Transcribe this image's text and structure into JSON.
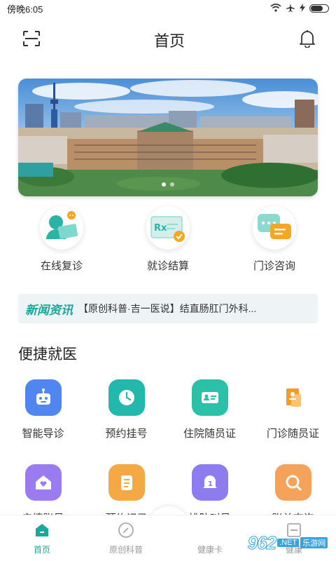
{
  "status_bar": {
    "time": "傍晚6:05",
    "battery_level": 0.7
  },
  "header": {
    "title": "首页",
    "scan_icon": "scan-icon",
    "bell_icon": "bell-icon"
  },
  "banner": {
    "slide_count": 2,
    "active_slide": 1
  },
  "quick_actions": [
    {
      "label": "在线复诊",
      "icon": "online-consult-icon"
    },
    {
      "label": "就诊结算",
      "icon": "prescription-icon"
    },
    {
      "label": "门诊咨询",
      "icon": "chat-icon"
    }
  ],
  "news": {
    "tag": "新闻资讯",
    "text": "【原创科普·吉一医说】结直肠肛门外科..."
  },
  "convenient": {
    "title": "便捷就医",
    "items": [
      {
        "label": "智能导诊",
        "icon": "robot-icon",
        "color": "#4f86f0"
      },
      {
        "label": "预约挂号",
        "icon": "clock-icon",
        "color": "#23b8ac"
      },
      {
        "label": "住院随员证",
        "icon": "id-card-icon",
        "color": "#2bc0a8"
      },
      {
        "label": "门诊随员证",
        "icon": "badge-icon",
        "color": "#f59a2c"
      },
      {
        "label": "亲情账号",
        "icon": "home-heart-icon",
        "color": "#9a7cf0"
      },
      {
        "label": "预约记录",
        "icon": "list-icon",
        "color": "#f5a944"
      },
      {
        "label": "排队叫号",
        "icon": "queue-bell-icon",
        "color": "#8c7cf0"
      },
      {
        "label": "账单查询",
        "icon": "search-icon",
        "color": "#f5a35a"
      }
    ]
  },
  "tabs": [
    {
      "label": "首页",
      "icon": "home-icon",
      "active": true
    },
    {
      "label": "原创科普",
      "icon": "compass-icon",
      "active": false
    },
    {
      "label": "健康卡",
      "icon": "qr-code-icon",
      "active": false
    },
    {
      "label": "健康",
      "icon": "health-icon",
      "active": false
    }
  ],
  "watermark": {
    "main": "962",
    "sub": "乐游网",
    "domain": ".NET"
  }
}
